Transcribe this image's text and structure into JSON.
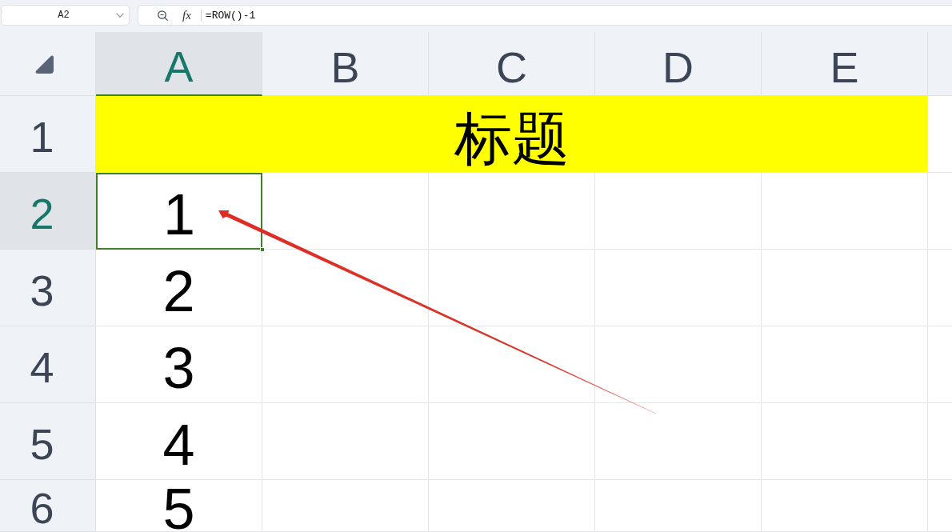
{
  "name_box": {
    "value": "A2"
  },
  "formula_bar": {
    "function_label": "fx",
    "value": "=ROW()-1"
  },
  "columns": [
    {
      "label": "A",
      "selected": true
    },
    {
      "label": "B",
      "selected": false
    },
    {
      "label": "C",
      "selected": false
    },
    {
      "label": "D",
      "selected": false
    },
    {
      "label": "E",
      "selected": false
    }
  ],
  "rows": [
    {
      "label": "1",
      "selected": false,
      "cells": [
        {
          "kind": "merged",
          "text": "标题",
          "color": "#ffff00",
          "selected": false
        }
      ]
    },
    {
      "label": "2",
      "selected": true,
      "cells": [
        {
          "kind": "value",
          "text": "1",
          "selected": true
        }
      ]
    },
    {
      "label": "3",
      "selected": false,
      "cells": [
        {
          "kind": "value",
          "text": "2",
          "selected": false
        }
      ]
    },
    {
      "label": "4",
      "selected": false,
      "cells": [
        {
          "kind": "value",
          "text": "3",
          "selected": false
        }
      ]
    },
    {
      "label": "5",
      "selected": false,
      "cells": [
        {
          "kind": "value",
          "text": "4",
          "selected": false
        }
      ]
    },
    {
      "label": "6",
      "selected": false,
      "cells": [
        {
          "kind": "value",
          "text": "5",
          "selected": false
        }
      ]
    }
  ]
}
